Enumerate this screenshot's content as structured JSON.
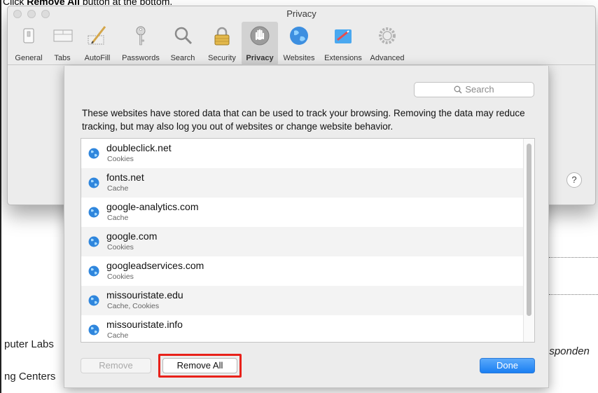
{
  "caption": {
    "prefix": "Click ",
    "bold": "Remove All",
    "suffix": " button at the bottom."
  },
  "window": {
    "title": "Privacy"
  },
  "toolbar": {
    "items": [
      {
        "label": "General",
        "icon": "general-icon"
      },
      {
        "label": "Tabs",
        "icon": "tabs-icon"
      },
      {
        "label": "AutoFill",
        "icon": "autofill-icon"
      },
      {
        "label": "Passwords",
        "icon": "key-icon"
      },
      {
        "label": "Search",
        "icon": "search-icon"
      },
      {
        "label": "Security",
        "icon": "lock-icon"
      },
      {
        "label": "Privacy",
        "icon": "hand-icon",
        "active": true
      },
      {
        "label": "Websites",
        "icon": "globe-icon"
      },
      {
        "label": "Extensions",
        "icon": "puzzle-icon"
      },
      {
        "label": "Advanced",
        "icon": "gear-icon"
      }
    ]
  },
  "help": {
    "label": "?"
  },
  "sheet": {
    "search_placeholder": "Search",
    "description": "These websites have stored data that can be used to track your browsing. Removing the data may reduce tracking, but may also log you out of websites or change website behavior.",
    "websites": [
      {
        "site": "doubleclick.net",
        "data": "Cookies"
      },
      {
        "site": "fonts.net",
        "data": "Cache"
      },
      {
        "site": "google-analytics.com",
        "data": "Cache"
      },
      {
        "site": "google.com",
        "data": "Cookies"
      },
      {
        "site": "googleadservices.com",
        "data": "Cookies"
      },
      {
        "site": "missouristate.edu",
        "data": "Cache, Cookies"
      },
      {
        "site": "missouristate.info",
        "data": "Cache"
      }
    ],
    "buttons": {
      "remove": "Remove",
      "remove_all": "Remove All",
      "done": "Done"
    }
  },
  "background": {
    "left_text_1": "puter Labs",
    "left_text_2": "ng Centers",
    "right_text": "esponden"
  },
  "colors": {
    "highlight": "#e8211a",
    "accent": "#1a7ff2"
  }
}
